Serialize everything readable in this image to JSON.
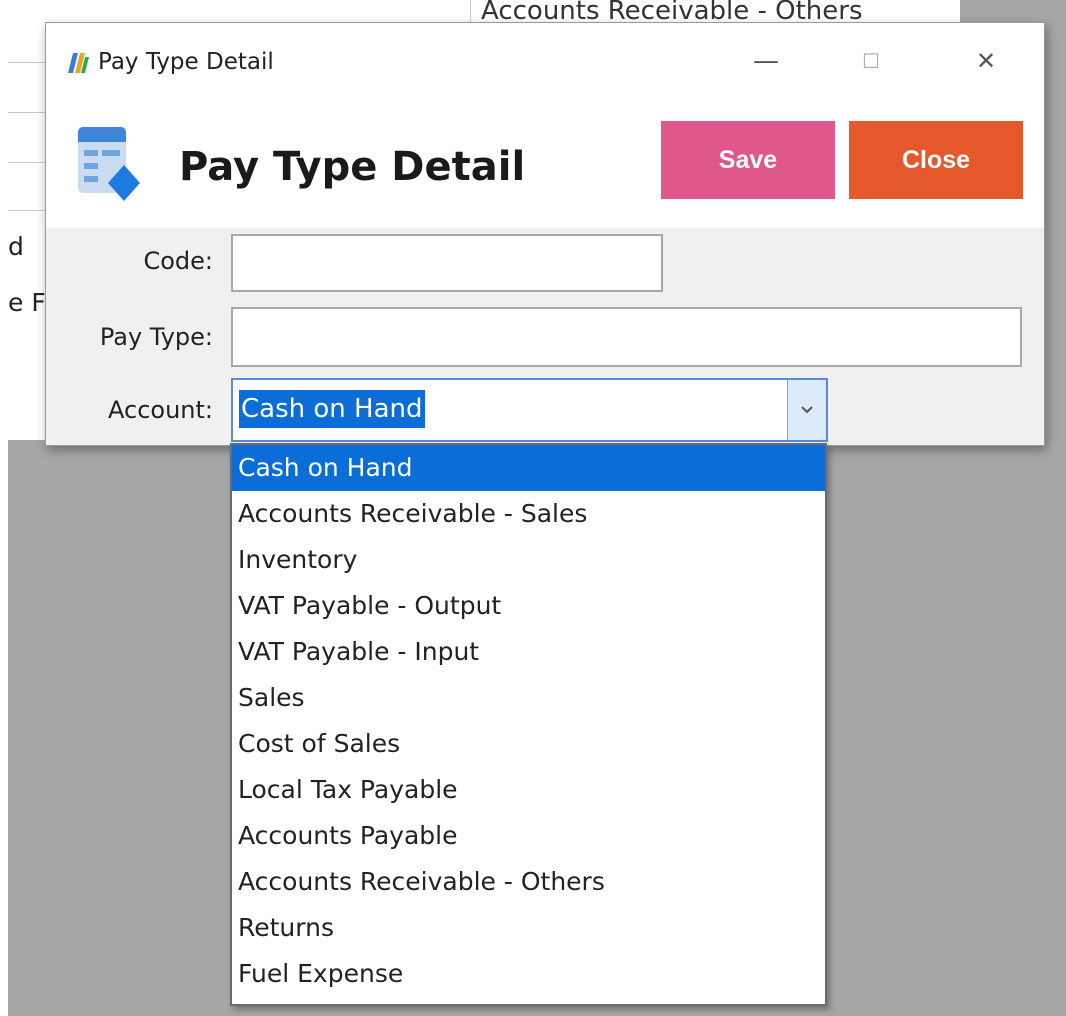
{
  "background": {
    "cell_text": "Accounts Receivable - Others",
    "fragment_1": "d",
    "fragment_2": "e F"
  },
  "window": {
    "title": "Pay Type Detail",
    "minimize_glyph": "—",
    "maximize_glyph": "☐",
    "close_glyph": "✕"
  },
  "header": {
    "title": "Pay Type Detail",
    "save_label": "Save",
    "close_label": "Close"
  },
  "form": {
    "code_label": "Code:",
    "code_value": "",
    "pay_type_label": "Pay Type:",
    "pay_type_value": "",
    "account_label": "Account:",
    "account_selected": "Cash on Hand"
  },
  "dropdown": {
    "items": [
      "Cash on Hand",
      "Accounts Receivable - Sales",
      "Inventory",
      "VAT Payable - Output",
      "VAT Payable - Input",
      "Sales",
      "Cost of Sales",
      "Local Tax Payable",
      "Accounts Payable",
      "Accounts Receivable - Others",
      "Returns",
      "Fuel Expense"
    ],
    "selected_index": 0
  },
  "icons": {
    "app": "app-logo-icon",
    "header": "table-edit-icon",
    "combo": "chevron-down-icon"
  },
  "colors": {
    "save": "#e0578c",
    "close": "#e4582b",
    "selection": "#0a6dd8"
  }
}
